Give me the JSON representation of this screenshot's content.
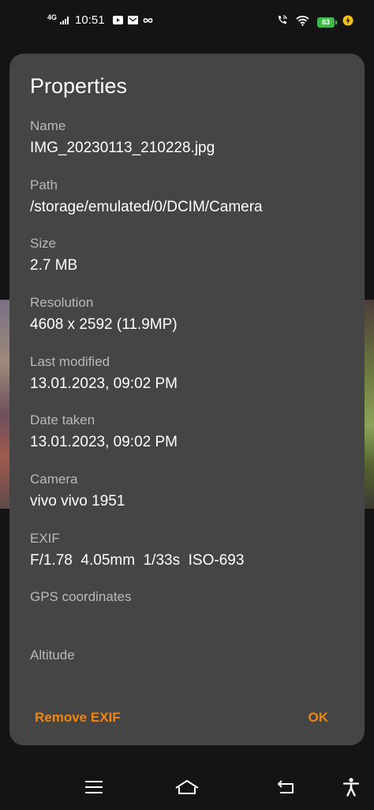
{
  "status": {
    "network": "4G",
    "time": "10:51",
    "battery": "83"
  },
  "dialog": {
    "title": "Properties",
    "properties": [
      {
        "label": "Name",
        "value": "IMG_20230113_210228.jpg"
      },
      {
        "label": "Path",
        "value": "/storage/emulated/0/DCIM/Camera"
      },
      {
        "label": "Size",
        "value": "2.7 MB"
      },
      {
        "label": "Resolution",
        "value": "4608 x 2592 (11.9MP)"
      },
      {
        "label": "Last modified",
        "value": "13.01.2023, 09:02 PM"
      },
      {
        "label": "Date taken",
        "value": "13.01.2023, 09:02 PM"
      },
      {
        "label": "Camera",
        "value": "vivo vivo 1951"
      },
      {
        "label": "EXIF",
        "value": "F/1.78  4.05mm  1/33s  ISO-693"
      },
      {
        "label": "GPS coordinates",
        "value": ""
      },
      {
        "label": "Altitude",
        "value": ""
      }
    ],
    "buttons": {
      "remove_exif": "Remove EXIF",
      "ok": "OK"
    }
  },
  "colors": {
    "accent": "#f0860e",
    "dialog_bg": "#454545",
    "label": "#b9b9b9",
    "battery": "#3dba4a"
  },
  "icons": {
    "statusbar": [
      "youtube-icon",
      "mail-icon",
      "infinity-icon",
      "wifi-calling-icon",
      "wifi-icon",
      "charging-icon"
    ],
    "navbar": [
      "menu-icon",
      "home-icon",
      "back-icon",
      "accessibility-icon"
    ]
  }
}
